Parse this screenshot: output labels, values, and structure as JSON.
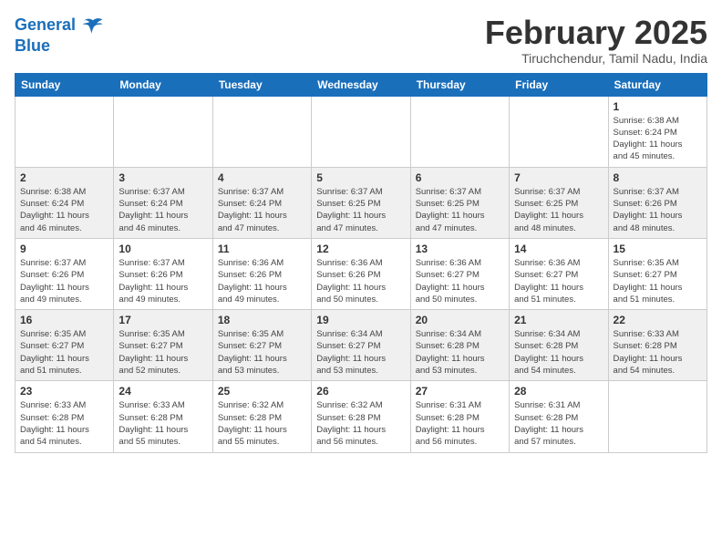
{
  "logo": {
    "line1": "General",
    "line2": "Blue"
  },
  "title": {
    "month_year": "February 2025",
    "location": "Tiruchchendur, Tamil Nadu, India"
  },
  "weekdays": [
    "Sunday",
    "Monday",
    "Tuesday",
    "Wednesday",
    "Thursday",
    "Friday",
    "Saturday"
  ],
  "weeks": [
    [
      {
        "day": "",
        "info": ""
      },
      {
        "day": "",
        "info": ""
      },
      {
        "day": "",
        "info": ""
      },
      {
        "day": "",
        "info": ""
      },
      {
        "day": "",
        "info": ""
      },
      {
        "day": "",
        "info": ""
      },
      {
        "day": "1",
        "info": "Sunrise: 6:38 AM\nSunset: 6:24 PM\nDaylight: 11 hours\nand 45 minutes."
      }
    ],
    [
      {
        "day": "2",
        "info": "Sunrise: 6:38 AM\nSunset: 6:24 PM\nDaylight: 11 hours\nand 46 minutes."
      },
      {
        "day": "3",
        "info": "Sunrise: 6:37 AM\nSunset: 6:24 PM\nDaylight: 11 hours\nand 46 minutes."
      },
      {
        "day": "4",
        "info": "Sunrise: 6:37 AM\nSunset: 6:24 PM\nDaylight: 11 hours\nand 47 minutes."
      },
      {
        "day": "5",
        "info": "Sunrise: 6:37 AM\nSunset: 6:25 PM\nDaylight: 11 hours\nand 47 minutes."
      },
      {
        "day": "6",
        "info": "Sunrise: 6:37 AM\nSunset: 6:25 PM\nDaylight: 11 hours\nand 47 minutes."
      },
      {
        "day": "7",
        "info": "Sunrise: 6:37 AM\nSunset: 6:25 PM\nDaylight: 11 hours\nand 48 minutes."
      },
      {
        "day": "8",
        "info": "Sunrise: 6:37 AM\nSunset: 6:26 PM\nDaylight: 11 hours\nand 48 minutes."
      }
    ],
    [
      {
        "day": "9",
        "info": "Sunrise: 6:37 AM\nSunset: 6:26 PM\nDaylight: 11 hours\nand 49 minutes."
      },
      {
        "day": "10",
        "info": "Sunrise: 6:37 AM\nSunset: 6:26 PM\nDaylight: 11 hours\nand 49 minutes."
      },
      {
        "day": "11",
        "info": "Sunrise: 6:36 AM\nSunset: 6:26 PM\nDaylight: 11 hours\nand 49 minutes."
      },
      {
        "day": "12",
        "info": "Sunrise: 6:36 AM\nSunset: 6:26 PM\nDaylight: 11 hours\nand 50 minutes."
      },
      {
        "day": "13",
        "info": "Sunrise: 6:36 AM\nSunset: 6:27 PM\nDaylight: 11 hours\nand 50 minutes."
      },
      {
        "day": "14",
        "info": "Sunrise: 6:36 AM\nSunset: 6:27 PM\nDaylight: 11 hours\nand 51 minutes."
      },
      {
        "day": "15",
        "info": "Sunrise: 6:35 AM\nSunset: 6:27 PM\nDaylight: 11 hours\nand 51 minutes."
      }
    ],
    [
      {
        "day": "16",
        "info": "Sunrise: 6:35 AM\nSunset: 6:27 PM\nDaylight: 11 hours\nand 51 minutes."
      },
      {
        "day": "17",
        "info": "Sunrise: 6:35 AM\nSunset: 6:27 PM\nDaylight: 11 hours\nand 52 minutes."
      },
      {
        "day": "18",
        "info": "Sunrise: 6:35 AM\nSunset: 6:27 PM\nDaylight: 11 hours\nand 53 minutes."
      },
      {
        "day": "19",
        "info": "Sunrise: 6:34 AM\nSunset: 6:27 PM\nDaylight: 11 hours\nand 53 minutes."
      },
      {
        "day": "20",
        "info": "Sunrise: 6:34 AM\nSunset: 6:28 PM\nDaylight: 11 hours\nand 53 minutes."
      },
      {
        "day": "21",
        "info": "Sunrise: 6:34 AM\nSunset: 6:28 PM\nDaylight: 11 hours\nand 54 minutes."
      },
      {
        "day": "22",
        "info": "Sunrise: 6:33 AM\nSunset: 6:28 PM\nDaylight: 11 hours\nand 54 minutes."
      }
    ],
    [
      {
        "day": "23",
        "info": "Sunrise: 6:33 AM\nSunset: 6:28 PM\nDaylight: 11 hours\nand 54 minutes."
      },
      {
        "day": "24",
        "info": "Sunrise: 6:33 AM\nSunset: 6:28 PM\nDaylight: 11 hours\nand 55 minutes."
      },
      {
        "day": "25",
        "info": "Sunrise: 6:32 AM\nSunset: 6:28 PM\nDaylight: 11 hours\nand 55 minutes."
      },
      {
        "day": "26",
        "info": "Sunrise: 6:32 AM\nSunset: 6:28 PM\nDaylight: 11 hours\nand 56 minutes."
      },
      {
        "day": "27",
        "info": "Sunrise: 6:31 AM\nSunset: 6:28 PM\nDaylight: 11 hours\nand 56 minutes."
      },
      {
        "day": "28",
        "info": "Sunrise: 6:31 AM\nSunset: 6:28 PM\nDaylight: 11 hours\nand 57 minutes."
      },
      {
        "day": "",
        "info": ""
      }
    ]
  ]
}
